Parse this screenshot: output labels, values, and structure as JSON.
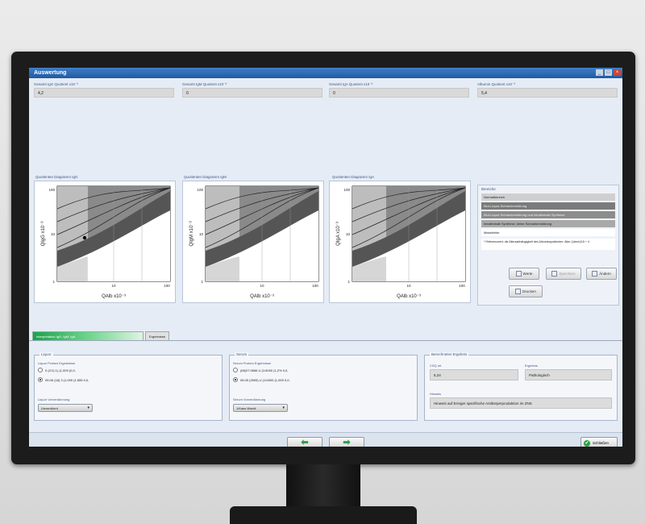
{
  "window": {
    "title": "Auswertung"
  },
  "quotients": [
    {
      "label": "Gesamt IgG Quotient x10⁻³",
      "value": "4,2"
    },
    {
      "label": "Gesamt IgM Quotient x10⁻³",
      "value": "0"
    },
    {
      "label": "Gesamt IgA Quotient x10⁻³",
      "value": "0"
    },
    {
      "label": "Albumin Quotient x10⁻³",
      "value": "5,4"
    }
  ],
  "diagrams": [
    {
      "title": "Quotienten Diagramm IgG",
      "ylabel": "QIgG x10⁻³",
      "xlabel": "QAlb x10⁻³",
      "yticks": [
        "100",
        "10",
        "1"
      ],
      "xticks": [
        "",
        "10",
        "100"
      ]
    },
    {
      "title": "Quotienten Diagramm IgM",
      "ylabel": "QIgM x10⁻³",
      "xlabel": "QAlb x10⁻³",
      "yticks": [
        "100",
        "10",
        "1"
      ],
      "xticks": [
        "",
        "10",
        "100"
      ]
    },
    {
      "title": "Quotienten Diagramm IgA",
      "ylabel": "QIgA x10⁻³",
      "xlabel": "QAlb x10⁻³",
      "yticks": [
        "100",
        "10",
        "1"
      ],
      "xticks": [
        "",
        "10",
        "100"
      ]
    }
  ],
  "results": {
    "title": "Bereiche",
    "rows": [
      "Normalbereich",
      "Blut-Liquor-Schrankenstörung",
      "Blut-Liquor-Schrankenstörung und intrathekale Synthese",
      "Intrathekale Synthese, keine Schrankenstörung",
      "Messfehler",
      "* Referenzwert: die Altersabhängigkeit des Albuminquotienten: Alter (Jahre)/15 + 4"
    ],
    "buttons": {
      "werte": "Werte",
      "speichern": "Speichern",
      "andern": "Ändern",
      "drucken": "Drucken"
    }
  },
  "tabs": [
    {
      "label": "Interpretation IgG, IgM, IgA",
      "active": true
    },
    {
      "label": "Ergebnisse",
      "active": false
    }
  ],
  "liquor": {
    "title": "Liquor",
    "subtitle": "Liquor Proben Ergebnisse",
    "radios": [
      {
        "label": "0 (2/1) 1) (1,009 (0,0,",
        "checked": false
      },
      {
        "label": "05.06 (18) 3 (1,009 (1,555 0,0,",
        "checked": true
      }
    ],
    "select_label": "Liquor Vorverdünnung",
    "select_value": "Unverdünnt"
  },
  "serum": {
    "title": "Serum",
    "subtitle": "Serum Proben Ergebnisse",
    "radios": [
      {
        "label": "(Mi)27.0656 U (1/4000 (1,2% 0,0,",
        "checked": false
      },
      {
        "label": "05.05 (2505) U (1/4000 (1,000 0,0,",
        "checked": true
      }
    ],
    "select_label": "Serum Vorverdünnung",
    "select_value": "1/Kass Wsmit"
  },
  "computed": {
    "title": "Berechnetes Ergebnis",
    "ai_label": "CSQ rel.",
    "ai_value": "5,24",
    "result_label": "Ergebnis",
    "result_value": "Pathologisch",
    "comment_label": "Hinweis",
    "comment_value": "Hinweis auf Erreger spezifische Antikörperproduktion im ZNS"
  },
  "footer": {
    "back_icon": "arrow-left-icon",
    "next_icon": "arrow-right-icon",
    "close_label": "Schließen"
  }
}
